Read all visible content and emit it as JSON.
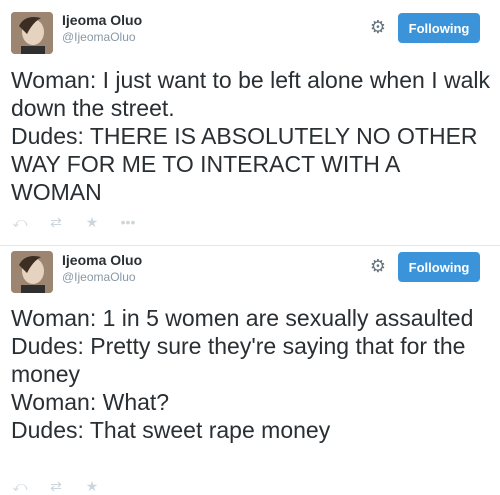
{
  "tweets": [
    {
      "author_name": "Ijeoma Oluo",
      "author_handle": "@IjeomaOluo",
      "follow_label": "Following",
      "text": "Woman: I just want to be left alone when I walk down the street.\nDudes: THERE IS ABSOLUTELY NO OTHER WAY FOR ME TO INTERACT WITH A WOMAN"
    },
    {
      "author_name": "Ijeoma Oluo",
      "author_handle": "@IjeomaOluo",
      "follow_label": "Following",
      "text": "Woman: 1 in 5 women are sexually assaulted\nDudes: Pretty sure they're saying that for the money\nWoman: What?\nDudes: That sweet rape money"
    }
  ],
  "icons": {
    "reply": "reply-icon",
    "retweet": "retweet-icon",
    "favorite": "star-icon",
    "more": "more-icon",
    "settings": "gear-icon"
  },
  "colors": {
    "follow_button": "#3b94d9",
    "text": "#292f33",
    "muted": "#8899a6",
    "action_icons": "#ccd6dd"
  }
}
